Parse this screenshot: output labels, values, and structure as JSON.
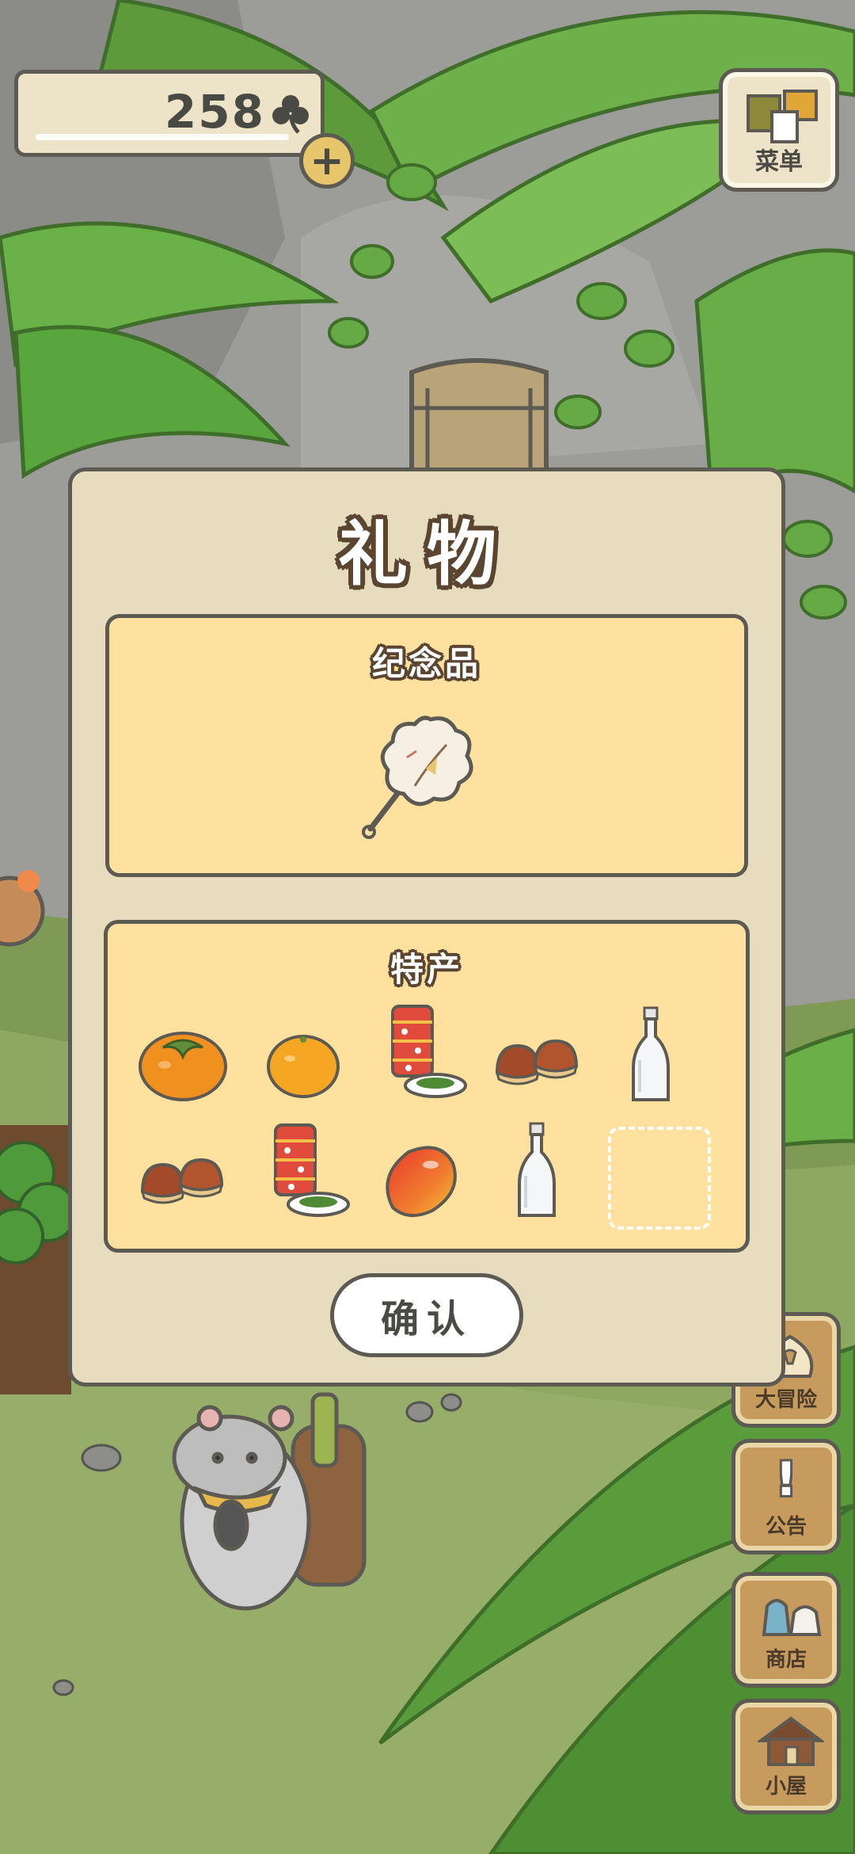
{
  "hud": {
    "clover_count": "258",
    "add_button_symbol": "+"
  },
  "menu_button": {
    "label": "菜单",
    "icon": "menu-cards-icon"
  },
  "side_buttons": [
    {
      "label": "大冒险",
      "icon": "adventure-icon"
    },
    {
      "label": "公告",
      "icon": "notice-icon",
      "glyph": "!"
    },
    {
      "label": "商店",
      "icon": "shop-icon"
    },
    {
      "label": "小屋",
      "icon": "house-icon"
    }
  ],
  "gift_dialog": {
    "title": "礼物",
    "souvenir": {
      "heading": "纪念品",
      "item": {
        "icon": "fan-souvenir-icon"
      }
    },
    "specialty": {
      "heading": "特产",
      "items": [
        {
          "icon": "persimmon-icon"
        },
        {
          "icon": "orange-icon"
        },
        {
          "icon": "tea-can-icon"
        },
        {
          "icon": "chestnuts-icon"
        },
        {
          "icon": "glass-bottle-icon"
        },
        {
          "icon": "chestnuts-icon"
        },
        {
          "icon": "tea-can-icon"
        },
        {
          "icon": "mango-icon"
        },
        {
          "icon": "glass-bottle-icon"
        },
        {
          "icon": "empty-slot"
        }
      ]
    },
    "confirm_label": "确认"
  },
  "colors": {
    "panel_fill": "#fee19f",
    "dialog_fill": "#e7dcbd",
    "outline": "#5c5a52",
    "title_outline": "#5a4530"
  }
}
